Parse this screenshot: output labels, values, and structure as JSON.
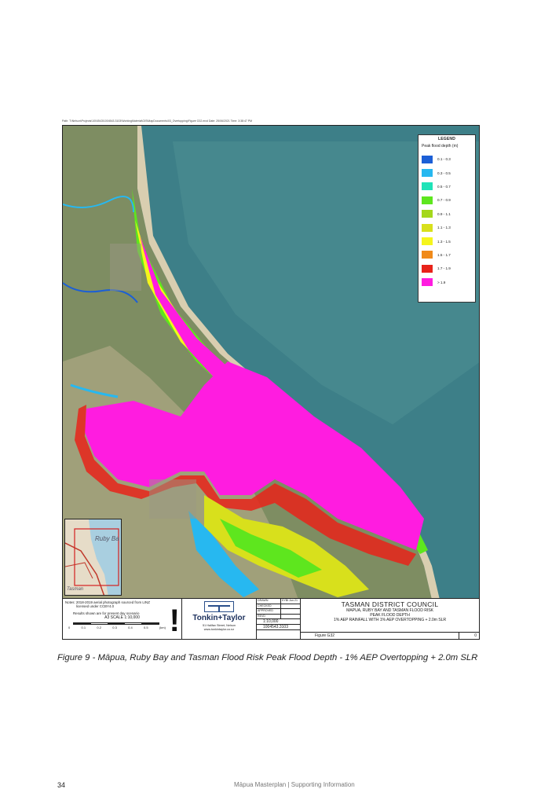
{
  "map": {
    "path_text": "Path: T:\\Nelson\\Projects\\1004543\\1004543.3103\\WorkingMaterial\\GIS\\MapDocuments\\03_Overtopping\\Figure G32.mxd  Date: 25/06/2021  Time: 3:38:47 PM",
    "legend": {
      "title": "LEGEND",
      "subtitle": "Peak flood depth (m)",
      "items": [
        {
          "label": "0.1 - 0.3",
          "color": "#1c5fd6"
        },
        {
          "label": "0.3 - 0.5",
          "color": "#27b8f0"
        },
        {
          "label": "0.5 - 0.7",
          "color": "#1fe3b8"
        },
        {
          "label": "0.7 - 0.9",
          "color": "#5ee61e"
        },
        {
          "label": "0.9 - 1.1",
          "color": "#a4d81c"
        },
        {
          "label": "1.1 - 1.3",
          "color": "#d8e01c"
        },
        {
          "label": "1.3 - 1.5",
          "color": "#f5f51c"
        },
        {
          "label": "1.5 - 1.7",
          "color": "#f08a1a"
        },
        {
          "label": "1.7 - 1.9",
          "color": "#e8231a"
        },
        {
          "label": "> 1.9",
          "color": "#ff1ce0"
        }
      ]
    },
    "inset": {
      "label": "Ruby Ba",
      "label2": "Tasman"
    },
    "title_block": {
      "notes_line1": "Notes: 2018-2019 aerial photograph sourced from LINZ",
      "notes_line2": "licensed under CCBY4.0",
      "notes_line3": "Results shown are for present day scenario",
      "scale_text": "A3 SCALE 1:10,000",
      "scale_ticks": [
        "0",
        "0.1",
        "0.2",
        "0.3",
        "0.4",
        "0.5",
        "(km)"
      ],
      "warning": "!",
      "company": "Tonkin+Taylor",
      "address1": "51 Halifax Street, Nelson",
      "address2": "www.tonkintaylor.co.nz",
      "meta": [
        {
          "k": "DRAWN",
          "v": "KYBt  Jun.21"
        },
        {
          "k": "CHECKED",
          "v": ""
        },
        {
          "k": "APPROVED",
          "v": ""
        },
        {
          "k": "REVD",
          "v": ""
        }
      ],
      "scale_value": "1:10,000",
      "project_no": "1004543.3103",
      "council": "TASMAN DISTRICT COUNCIL",
      "line1": "MAPUA, RUBY BAY AND TASMAN FLOOD RISK",
      "line2": "PEAK FLOOD DEPTH",
      "line3": "1% AEP RAINFALL WITH 1% AEP OVERTOPPING + 2.0m SLR",
      "figure": "Figure G32",
      "rev": "0"
    }
  },
  "caption": "Figure 9 -  Māpua, Ruby Bay and Tasman Flood Risk Peak Flood Depth - 1% AEP Overtopping + 2.0m SLR",
  "footer": {
    "page_number": "34",
    "doc_title": "Māpua Masterplan | Supporting Information"
  }
}
